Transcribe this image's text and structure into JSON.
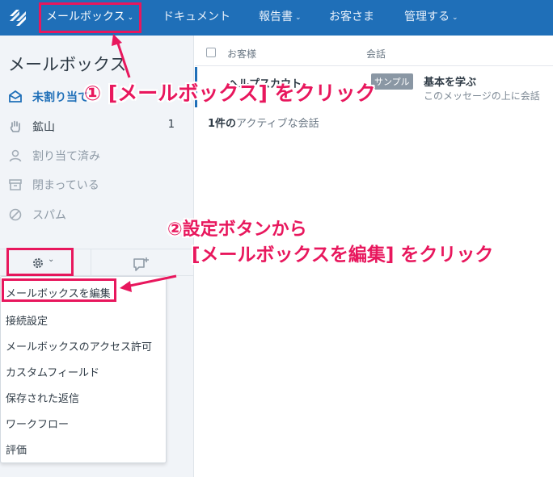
{
  "topnav": {
    "items": [
      {
        "label": "メールボックス",
        "caret": "⌄"
      },
      {
        "label": "ドキュメント",
        "caret": ""
      },
      {
        "label": "報告書",
        "caret": "⌄"
      },
      {
        "label": "お客さま",
        "caret": ""
      },
      {
        "label": "管理する",
        "caret": "⌄"
      }
    ]
  },
  "sidebar": {
    "title": "メールボックス",
    "items": [
      {
        "label": "未割り当て",
        "count": "",
        "icon": "inbox-icon"
      },
      {
        "label": "鉱山",
        "count": "1",
        "icon": "hand-icon"
      },
      {
        "label": "割り当て済み",
        "count": "",
        "icon": "person-icon"
      },
      {
        "label": "閉まっている",
        "count": "",
        "icon": "archive-icon"
      },
      {
        "label": "スパム",
        "count": "",
        "icon": "block-icon"
      }
    ],
    "settings_caret": "⌄"
  },
  "dropdown": {
    "items": [
      "メールボックスを編集",
      "接続設定",
      "メールボックスのアクセス許可",
      "カスタムフィールド",
      "保存された返信",
      "ワークフロー",
      "評価"
    ]
  },
  "main": {
    "header": {
      "customer": "お客様",
      "conversation": "会話"
    },
    "row": {
      "customer": "ヘルプスカウト",
      "tag": "サンプル",
      "subject": "基本を学ぶ",
      "preview": "このメッセージの上に会話"
    },
    "active_count_num": "1件の",
    "active_count_text": "アクティブな会話"
  },
  "annotations": {
    "step1": "① [メールボックス] をクリック",
    "step2_line1": "②設定ボタンから",
    "step2_line2": "[メールボックスを編集] をクリック"
  },
  "colors": {
    "nav_bg": "#1f6fb8",
    "accent": "#e8175d",
    "sidebar_bg": "#f1f4f8"
  }
}
